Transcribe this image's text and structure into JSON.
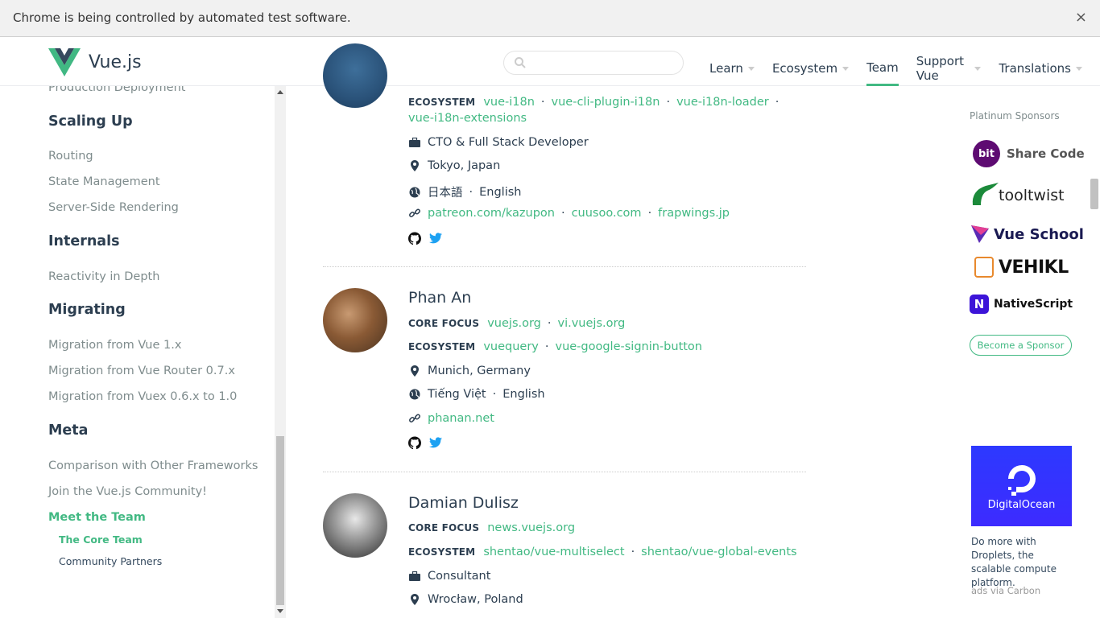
{
  "infobar": {
    "text": "Chrome is being controlled by automated test software.",
    "close": "×"
  },
  "header": {
    "logo_text": "Vue.js",
    "nav": [
      {
        "label": "Learn",
        "dropdown": true
      },
      {
        "label": "Ecosystem",
        "dropdown": true
      },
      {
        "label": "Team",
        "dropdown": false
      },
      {
        "label": "Support Vue",
        "dropdown": true
      },
      {
        "label": "Translations",
        "dropdown": true
      }
    ]
  },
  "sidebar": {
    "prev_link": "Production Deployment",
    "sections": [
      {
        "title": "Scaling Up",
        "links": [
          "Routing",
          "State Management",
          "Server-Side Rendering"
        ]
      },
      {
        "title": "Internals",
        "links": [
          "Reactivity in Depth"
        ]
      },
      {
        "title": "Migrating",
        "links": [
          "Migration from Vue 1.x",
          "Migration from Vue Router 0.7.x",
          "Migration from Vuex 0.6.x to 1.0"
        ]
      },
      {
        "title": "Meta",
        "links": [
          "Comparison with Other Frameworks",
          "Join the Vue.js Community!",
          "Meet the Team"
        ]
      }
    ],
    "sub_links": [
      "The Core Team",
      "Community Partners"
    ]
  },
  "members": [
    {
      "name": "",
      "ecosystem_label": "ECOSYSTEM",
      "ecosystem": [
        "vue-i18n",
        "vue-cli-plugin-i18n",
        "vue-i18n-loader",
        "vue-i18n-extensions"
      ],
      "work": "CTO & Full Stack Developer",
      "location": "Tokyo, Japan",
      "languages": [
        "日本語",
        "English"
      ],
      "links": [
        "patreon.com/kazupon",
        "cuusoo.com",
        "frapwings.jp"
      ]
    },
    {
      "name": "Phan An",
      "core_label": "CORE FOCUS",
      "core": [
        "vuejs.org",
        "vi.vuejs.org"
      ],
      "ecosystem_label": "ECOSYSTEM",
      "ecosystem": [
        "vuequery",
        "vue-google-signin-button"
      ],
      "location": "Munich, Germany",
      "languages": [
        "Tiếng Việt",
        "English"
      ],
      "links": [
        "phanan.net"
      ]
    },
    {
      "name": "Damian Dulisz",
      "core_label": "CORE FOCUS",
      "core": [
        "news.vuejs.org"
      ],
      "ecosystem_label": "ECOSYSTEM",
      "ecosystem": [
        "shentao/vue-multiselect",
        "shentao/vue-global-events"
      ],
      "work": "Consultant",
      "location": "Wrocław, Poland"
    }
  ],
  "sponsors": {
    "label": "Platinum Sponsors",
    "items": [
      "Share Code",
      "tooltwist",
      "Vue School",
      "VEHIKL",
      "NativeScript"
    ],
    "bit_badge": "bit",
    "become": "Become a Sponsor"
  },
  "carbon": {
    "brand": "DigitalOcean",
    "text": "Do more with Droplets, the scalable compute platform.",
    "via": "ads via Carbon"
  },
  "colors": {
    "accent": "#42b983",
    "text": "#2c3e50",
    "muted": "#7f8c8d"
  }
}
